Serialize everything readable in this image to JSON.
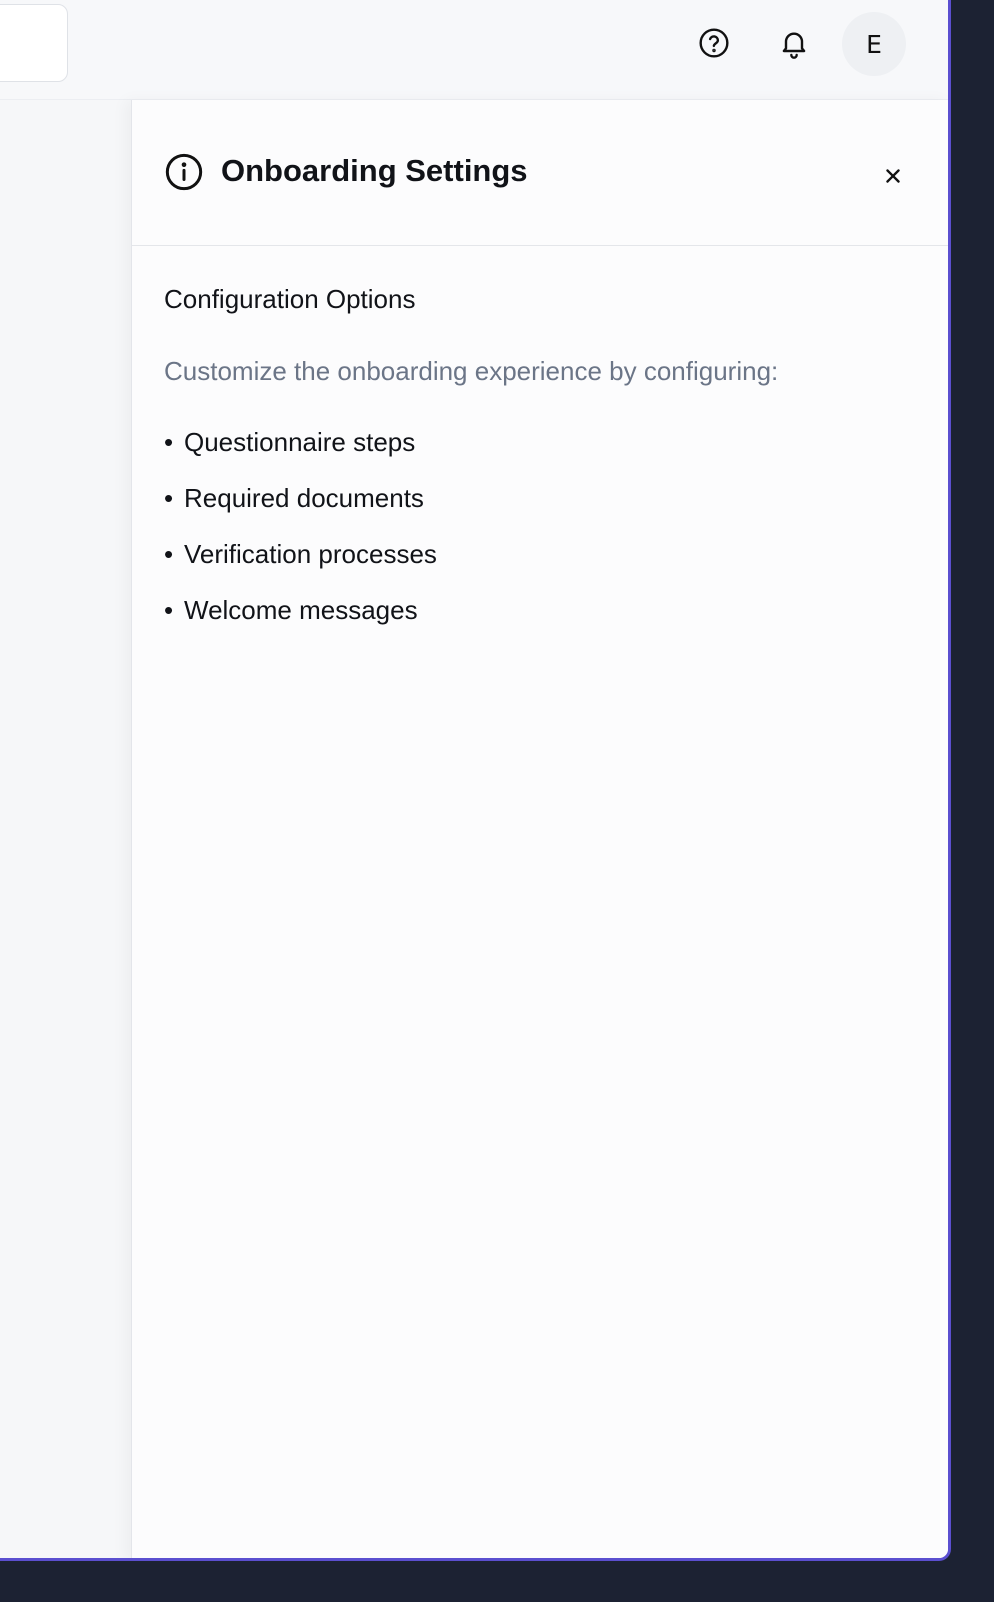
{
  "topbar": {
    "avatar_initial": "E",
    "icons": [
      "help-circle-icon",
      "bell-icon"
    ]
  },
  "panel": {
    "title": "Onboarding Settings",
    "header_icon": "info-circle-icon",
    "close_icon": "close-icon",
    "section": {
      "title": "Configuration Options",
      "description": "Customize the onboarding experience by configuring:",
      "items": [
        {
          "bullet": "•",
          "label": "Questionnaire steps"
        },
        {
          "bullet": "•",
          "label": "Required documents"
        },
        {
          "bullet": "•",
          "label": "Verification processes"
        },
        {
          "bullet": "•",
          "label": "Welcome messages"
        }
      ]
    }
  },
  "colors": {
    "accent_border": "#5b4fd0",
    "muted_text": "#6b7587",
    "outer_background": "#1c2233"
  }
}
